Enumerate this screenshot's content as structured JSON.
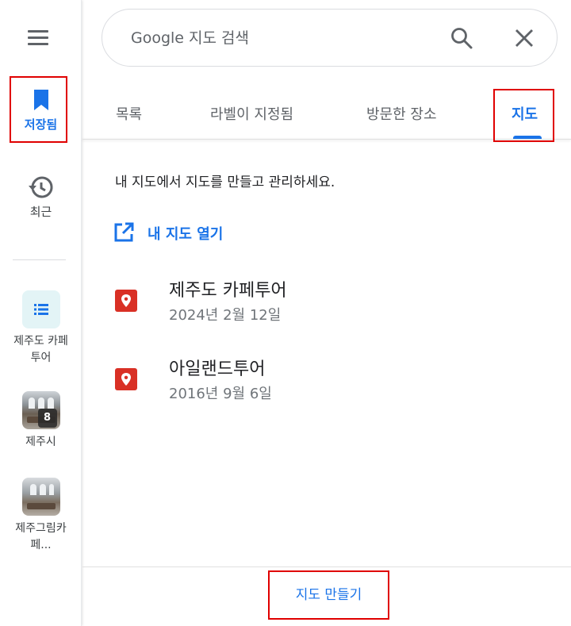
{
  "rail": {
    "saved_label": "저장됨",
    "recent_label": "최근",
    "lists": [
      {
        "label_line1": "제주도 카페",
        "label_line2": "투어",
        "icon": "list-icon"
      },
      {
        "label_line1": "제주시",
        "label_line2": "",
        "badge": "8",
        "icon": "photo-thumbnail"
      },
      {
        "label_line1": "제주그림카",
        "label_line2": "페...",
        "icon": "photo-thumbnail"
      }
    ]
  },
  "search": {
    "placeholder": "Google 지도 검색",
    "value": ""
  },
  "tabs": [
    {
      "label": "목록",
      "active": false
    },
    {
      "label": "라벨이 지정됨",
      "active": false
    },
    {
      "label": "방문한 장소",
      "active": false
    },
    {
      "label": "지도",
      "active": true
    }
  ],
  "content": {
    "intro": "내 지도에서 지도를 만들고 관리하세요.",
    "open_link": "내 지도 열기",
    "maps": [
      {
        "name": "제주도 카페투어",
        "date": "2024년 2월 12일"
      },
      {
        "name": "아일랜드투어",
        "date": "2016년 9월 6일"
      }
    ]
  },
  "footer": {
    "create_label": "지도 만들기"
  },
  "colors": {
    "accent": "#1a73e8",
    "pin": "#d93025",
    "highlight": "#e00000"
  }
}
